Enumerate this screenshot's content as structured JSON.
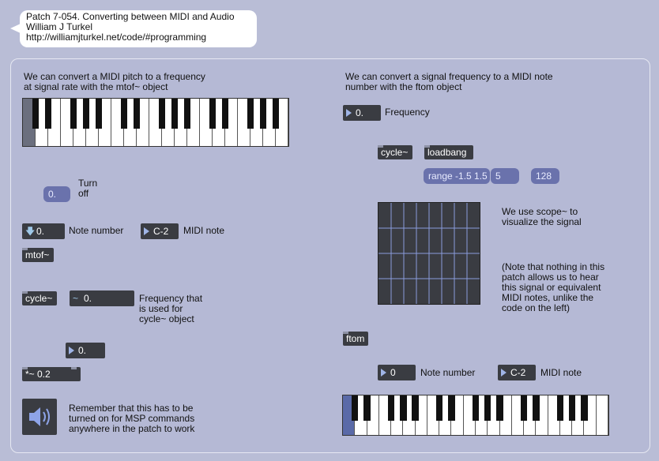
{
  "header": {
    "title_line1": "Patch 7-054. Converting between MIDI and Audio",
    "title_line2": "William J Turkel",
    "title_line3": "http://williamjturkel.net/code/#programming"
  },
  "left": {
    "intro": "We can convert a MIDI pitch to a frequency\nat signal rate with the mtof~ object",
    "turn_off_number": "0.",
    "turn_off_label": "Turn\noff",
    "note_number_value": "0.",
    "note_number_label": "Note number",
    "midi_note_value": "C-2",
    "midi_note_label": "MIDI note",
    "mtof_label": "mtof~",
    "cycle_label": "cycle~",
    "freq_signal_value": "0.",
    "freq_label": "Frequency that\nis used for\ncycle~ object",
    "gain_number_value": "0.",
    "mult_label": "*~ 0.2",
    "dac_note": "Remember that this has to be\nturned on for MSP commands\nanywhere in the patch to work"
  },
  "right": {
    "intro": "We can convert a signal frequency to a MIDI note\nnumber with the ftom object",
    "frequency_value": "0.",
    "frequency_label": "Frequency",
    "cycle_label": "cycle~",
    "loadbang_label": "loadbang",
    "range_label": "range -1.5 1.5",
    "five_label": "5",
    "n128_label": "128",
    "scope_note": "We use scope~ to\nvisualize the signal",
    "hear_note": "(Note that nothing in this\npatch allows us to hear\nthis signal or equivalent\nMIDI notes, unlike the\ncode on the left)",
    "ftom_label": "ftom",
    "note_number_value": "0",
    "note_number_label": "Note number",
    "midi_note_value": "C-2",
    "midi_note_label": "MIDI note"
  },
  "icons": {
    "speaker": "speaker-icon",
    "down_arrow": "down-arrow-icon",
    "tilde": "tilde-icon"
  },
  "colors": {
    "background": "#b9bdd6",
    "object": "#3a3c42",
    "message": "#6a72ac",
    "patch_cord": "#3a3c42",
    "signal_cord": "#c8d66a"
  }
}
